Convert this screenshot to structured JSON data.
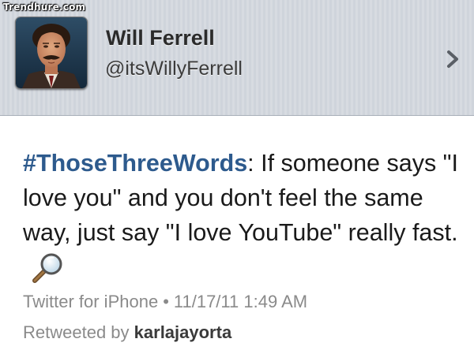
{
  "watermark": "Trendhure.com",
  "profile": {
    "name": "Will Ferrell",
    "handle": "@itsWillyFerrell"
  },
  "tweet": {
    "hashtag": "#ThoseThreeWords",
    "text_after_hashtag": ": If someone says \"I love you\" and you don't feel the same way, just say \"I love YouTube\" really fast.",
    "source": "Twitter for iPhone",
    "separator": "•",
    "timestamp": "11/17/11 1:49 AM",
    "retweeted_prefix": "Retweeted by",
    "retweeted_by": "karlajayorta"
  },
  "icons": {
    "chevron": "chevron-right-icon",
    "magnifier": "magnifier-icon"
  },
  "colors": {
    "hashtag": "#2d5a8d",
    "meta_gray": "#8a8a8a",
    "header_bg": "#d4d8de"
  }
}
